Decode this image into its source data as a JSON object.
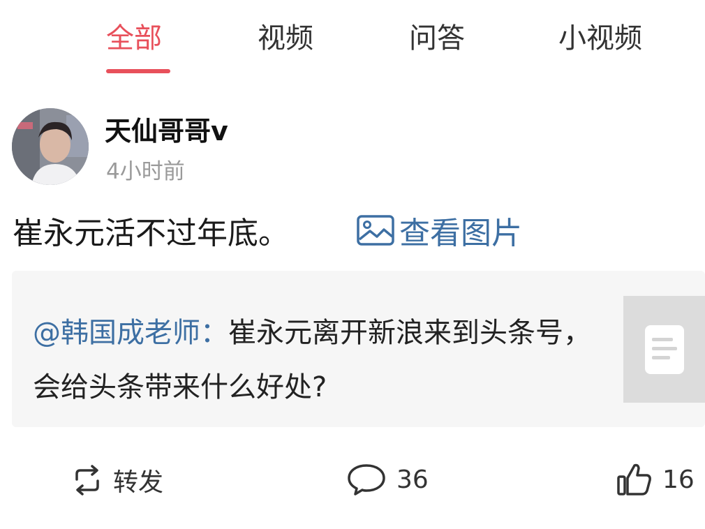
{
  "tabs": [
    {
      "label": "全部",
      "active": true
    },
    {
      "label": "视频",
      "active": false
    },
    {
      "label": "问答",
      "active": false
    },
    {
      "label": "小视频",
      "active": false
    }
  ],
  "post": {
    "author": "天仙哥哥v",
    "time": "4小时前",
    "text": "崔永元活不过年底。",
    "view_images_label": "查看图片"
  },
  "quote": {
    "mention": "@韩国成老师：",
    "text": "崔永元离开新浪来到头条号，会给头条带来什么好处?"
  },
  "actions": {
    "repost_label": "转发",
    "comment_count": "36",
    "like_count": "16"
  },
  "colors": {
    "accent": "#e8505b",
    "link": "#3d6fa3"
  },
  "icons": [
    "picture-icon",
    "document-icon",
    "repost-icon",
    "comment-icon",
    "like-icon"
  ]
}
